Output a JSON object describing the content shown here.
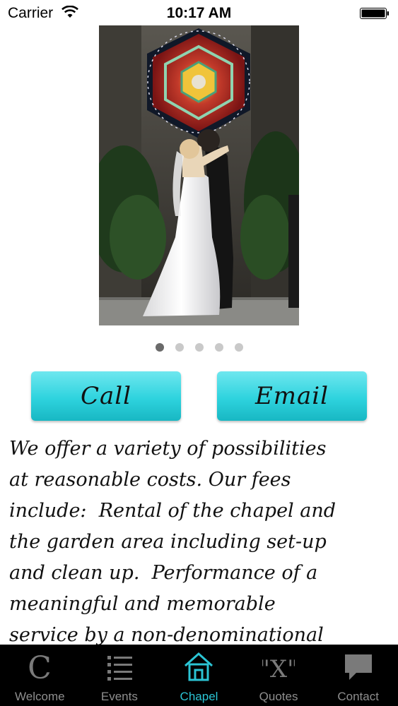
{
  "status_bar": {
    "carrier": "Carrier",
    "time": "10:17 AM",
    "wifi_icon": "wifi-icon",
    "battery_icon": "battery-icon"
  },
  "carousel": {
    "page_count": 5,
    "active_index": 0
  },
  "actions": {
    "call_label": "Call",
    "email_label": "Email",
    "button_color": "#2ed3de"
  },
  "description": {
    "lines": [
      "We offer a variety of possibilities",
      "at reasonable costs. Our fees",
      "include:  Rental of the chapel and",
      "the garden area including set-up",
      "and clean up.  Performance of a",
      "meaningful and memorable",
      "service by a non-denominational"
    ]
  },
  "tab_bar": {
    "selected_color": "#2bc4d4",
    "items": [
      {
        "label": "Welcome",
        "icon": "welcome-c-icon",
        "selected": false
      },
      {
        "label": "Events",
        "icon": "list-icon",
        "selected": false
      },
      {
        "label": "Chapel",
        "icon": "chapel-house-icon",
        "selected": true
      },
      {
        "label": "Quotes",
        "icon": "quote-x-icon",
        "selected": false
      },
      {
        "label": "Contact",
        "icon": "speech-bubble-icon",
        "selected": false
      }
    ]
  }
}
